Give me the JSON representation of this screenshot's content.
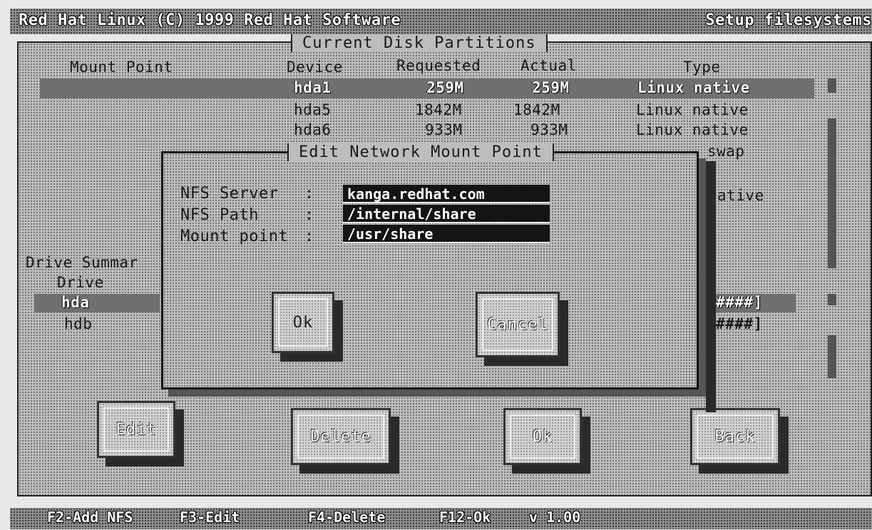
{
  "top_bar": {
    "left_title": "Red Hat Linux (C) 1999 Red Hat Software",
    "right_title": "Setup filesystems"
  },
  "partitions": {
    "frame_title": "Current Disk Partitions",
    "headers": {
      "mount_point": "Mount Point",
      "device": "Device",
      "requested": "Requested",
      "actual": "Actual",
      "type": "Type"
    },
    "rows": [
      {
        "device": "hda1",
        "requested": "259M",
        "actual": "259M",
        "type": "Linux native"
      },
      {
        "device": "hda5",
        "requested": "1842M",
        "actual": "1842M",
        "type": "Linux native"
      },
      {
        "device": "hda6",
        "requested": "933M",
        "actual": "933M",
        "type": "Linux native"
      },
      {
        "type": "swap"
      },
      {
        "type": "ative"
      }
    ]
  },
  "drive_summary": {
    "title": "Drive Summar",
    "column": "Drive",
    "drives": [
      "hda",
      "hdb"
    ],
    "bar_tail_1": "####]",
    "bar_tail_2": "####]"
  },
  "dialog": {
    "title": "Edit Network Mount Point",
    "fields": [
      {
        "label": "NFS Server",
        "sep": ":",
        "value": "kanga.redhat.com"
      },
      {
        "label": "NFS Path",
        "sep": ":",
        "value": "/internal/share"
      },
      {
        "label": "Mount point",
        "sep": ":",
        "value": "/usr/share"
      }
    ],
    "ok_label": "Ok",
    "cancel_label": "Cancel"
  },
  "main_buttons": {
    "edit": "Edit",
    "delete": "Delete",
    "ok": "Ok",
    "back": "Back"
  },
  "bottom_bar": {
    "f2": "F2-Add NFS",
    "f3": "F3-Edit",
    "f4": "F4-Delete",
    "f12": "F12-Ok",
    "version": "v 1.00"
  }
}
